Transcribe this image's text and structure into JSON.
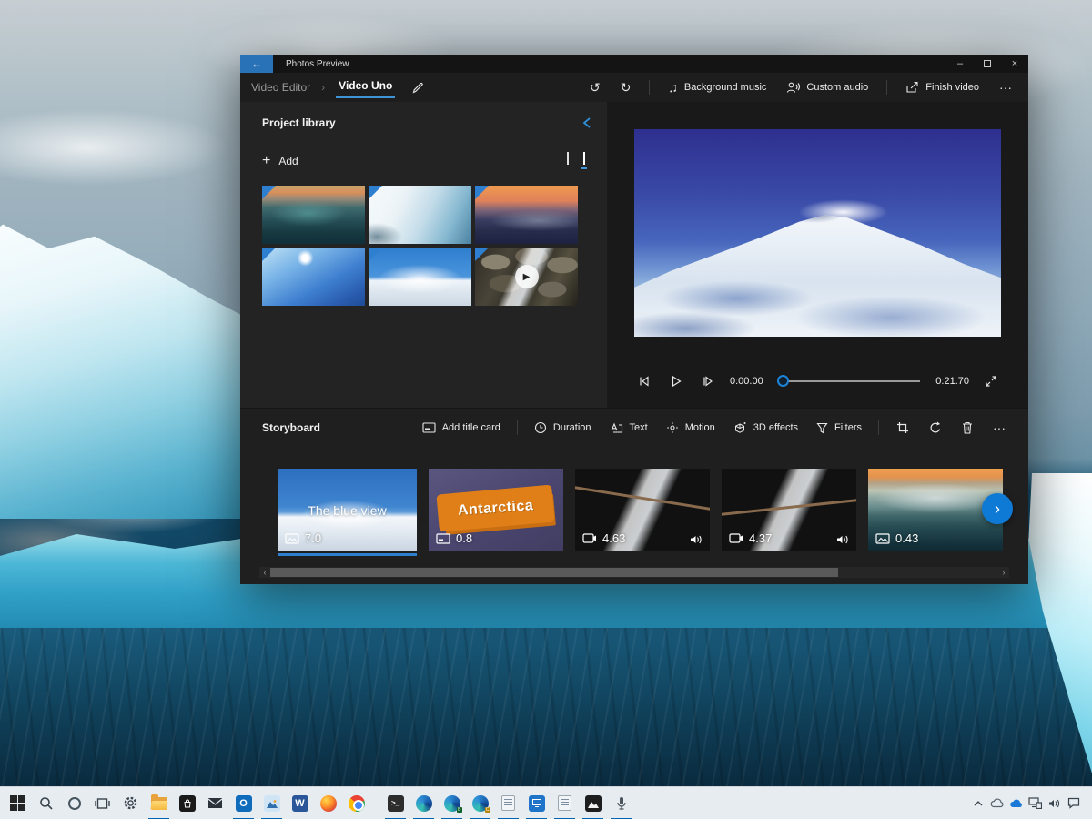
{
  "glyphs": {
    "back": "←",
    "minimize": "–",
    "close": "×",
    "undo": "↺",
    "redo": "↻",
    "music": "♫",
    "more": "···",
    "breadcrumb_sep": "›",
    "add_plus": "+",
    "scroll_left": "‹",
    "scroll_right": "›",
    "next_arrow": "›",
    "play_overlay": "▶",
    "tray_chevron": "⌃",
    "terminal_prompt": ">_",
    "word_letter": "W",
    "outlook_letter": "O"
  },
  "window": {
    "title": "Photos Preview",
    "breadcrumb": {
      "section": "Video Editor",
      "project": "Video Uno"
    },
    "topbar": {
      "background_music": "Background music",
      "custom_audio": "Custom audio",
      "finish_video": "Finish video"
    }
  },
  "library": {
    "title": "Project library",
    "add": "Add",
    "thumbnails": [
      {
        "name": "iceberg-sunset-dark",
        "in_storyboard": true
      },
      {
        "name": "iceberg-closeup",
        "in_storyboard": true
      },
      {
        "name": "iceberg-sunset-orange",
        "in_storyboard": true
      },
      {
        "name": "ice-slope-sun",
        "in_storyboard": true
      },
      {
        "name": "snow-mountain",
        "in_storyboard": true
      },
      {
        "name": "rocky-stream-video",
        "in_storyboard": true,
        "is_video": true
      }
    ]
  },
  "player": {
    "elapsed": "0:00.00",
    "total": "0:21.70"
  },
  "storyboard": {
    "title": "Storyboard",
    "toolbar": {
      "add_title_card": "Add title card",
      "duration": "Duration",
      "text": "Text",
      "motion": "Motion",
      "effects_3d": "3D effects",
      "filters": "Filters"
    },
    "clips": [
      {
        "title": "The blue view",
        "duration": "7.0",
        "kind": "image",
        "selected": true
      },
      {
        "title": "Antarctica",
        "duration": "0.8",
        "kind": "title-card"
      },
      {
        "duration": "4.63",
        "kind": "video",
        "has_audio": true
      },
      {
        "duration": "4.37",
        "kind": "video",
        "has_audio": true
      },
      {
        "duration": "0.43",
        "kind": "image"
      }
    ]
  },
  "taskbar": {
    "items": [
      "start",
      "search",
      "cortana",
      "task-view",
      "settings",
      "file-explorer",
      "store",
      "mail",
      "outlook",
      "photos",
      "word",
      "firefox",
      "chrome",
      "terminal",
      "edge",
      "edge-beta",
      "edge-canary",
      "notepad",
      "movies-tv",
      "notepad-2",
      "photos-dark",
      "voice-recorder"
    ],
    "tray": [
      "show-hidden",
      "onedrive-gray",
      "onedrive-blue",
      "display-network",
      "volume",
      "action-center"
    ]
  },
  "colors": {
    "accent": "#2e7fd0",
    "taskbar_indicator": "#0063b1",
    "window_bg": "#1d1d1d"
  }
}
